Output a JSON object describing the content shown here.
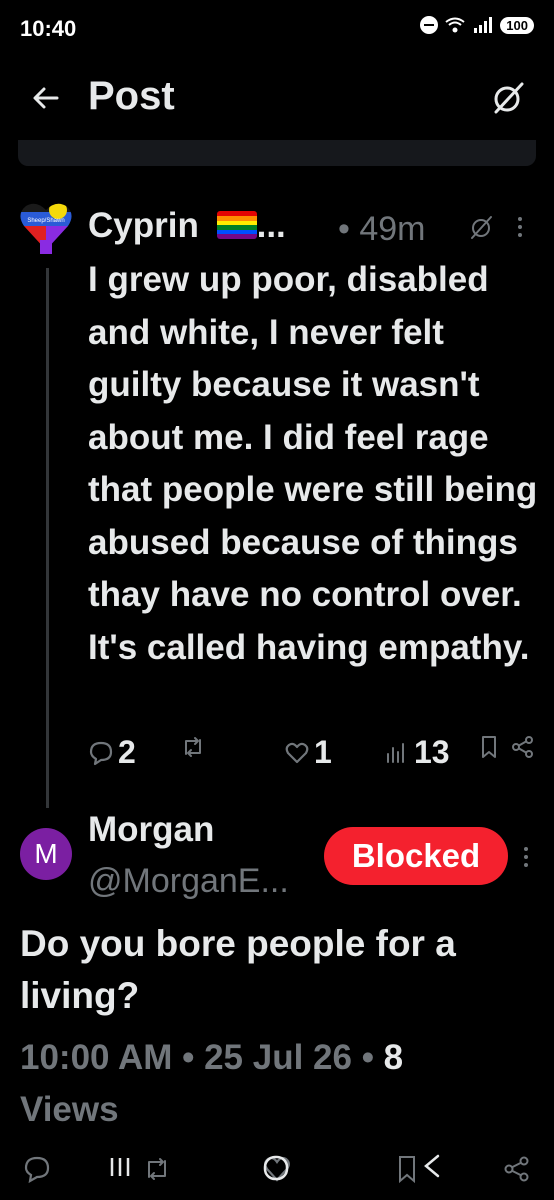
{
  "status_bar": {
    "time": "10:40",
    "battery": "100",
    "wifi_badge": "5"
  },
  "header": {
    "title": "Post"
  },
  "reply": {
    "author_name": "Cyprin",
    "ellipsis": "...",
    "separator": "•",
    "time_ago": "49m",
    "text": "I grew up poor, disabled and white, I never felt guilty because it wasn't about me. I did feel rage that people were still being abused because of things thay have no control over. It's called having empathy.",
    "replies": "2",
    "reposts": "",
    "likes": "1",
    "views": "13",
    "avatar_text": "Sheep/Shawn"
  },
  "main_post": {
    "author_name": "Morgan",
    "handle": "@MorganE...",
    "avatar_letter": "M",
    "blocked_label": "Blocked",
    "text": "Do you bore people for a living?",
    "time": "10:00 AM",
    "sep1": " • ",
    "date": "25 Jul 26",
    "sep2": " • ",
    "views_count": "8",
    "views_label": "Views"
  },
  "colors": {
    "accent_red": "#f4212e",
    "muted": "#71767b",
    "text": "#e7e9ea",
    "avatar_purple": "#7b1fa2"
  }
}
